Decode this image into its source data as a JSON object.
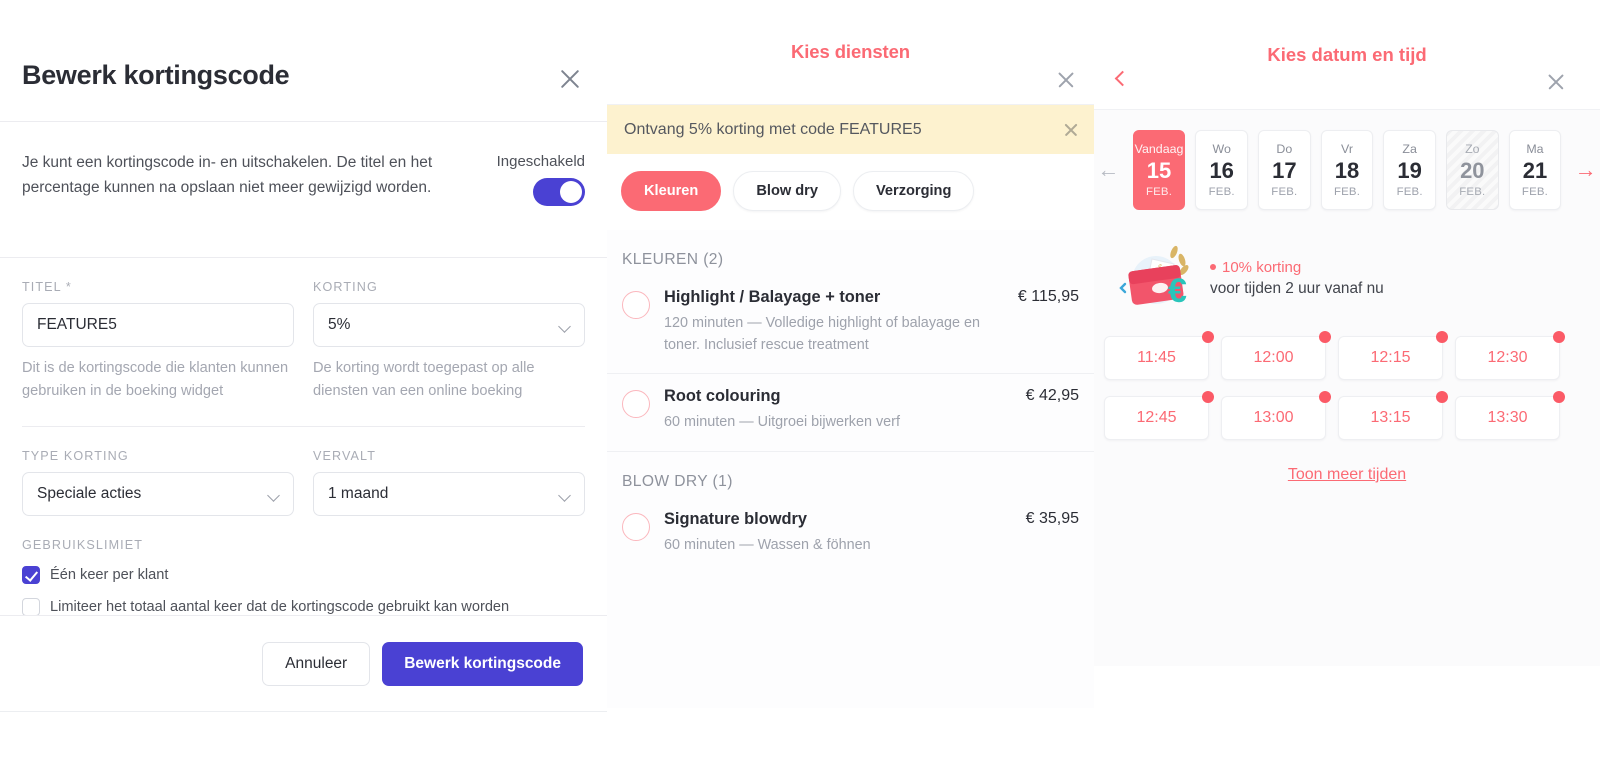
{
  "theme": {
    "accent_red": "#fb6a74",
    "accent_purple": "#4a41d3",
    "promo_yellow": "#fdf2cf"
  },
  "edit_modal": {
    "title": "Bewerk kortingscode",
    "close_icon": "close-icon",
    "intro": "Je kunt een kortingscode in- en uitschakelen. De titel en het percentage kunnen na opslaan niet meer gewijzigd worden.",
    "toggle": {
      "label": "Ingeschakeld",
      "state": "on"
    },
    "fields": {
      "titel": {
        "label": "TITEL *",
        "value": "FEATURE5",
        "placeholder": "FEATURE5",
        "help": "Dit is de kortingscode die klanten kunnen gebruiken in de boeking widget"
      },
      "korting": {
        "label": "KORTING",
        "value": "5%",
        "help": "De korting wordt toegepast op alle diensten van een online boeking"
      },
      "type_korting": {
        "label": "TYPE KORTING",
        "value": "Speciale acties"
      },
      "vervalt": {
        "label": "VERVALT",
        "value": "1 maand"
      }
    },
    "usage_limit": {
      "label": "GEBRUIKSLIMIET",
      "options": [
        {
          "label": "Één keer per klant",
          "checked": true
        },
        {
          "label": "Limiteer het totaal aantal keer dat de kortingscode gebruikt kan worden",
          "checked": false
        }
      ]
    },
    "footer": {
      "cancel": "Annuleer",
      "submit": "Bewerk kortingscode"
    }
  },
  "services_panel": {
    "title": "Kies diensten",
    "close_icon": "close-icon",
    "promo": {
      "text": "Ontvang 5% korting met code FEATURE5",
      "close_icon": "close-icon"
    },
    "chips": [
      {
        "label": "Kleuren",
        "active": true
      },
      {
        "label": "Blow dry",
        "active": false
      },
      {
        "label": "Verzorging",
        "active": false
      }
    ],
    "groups": [
      {
        "title": "KLEUREN (2)",
        "items": [
          {
            "name": "Highlight / Balayage + toner",
            "price": "€ 115,95",
            "desc": "120 minuten — Volledige highlight of balayage en toner. Inclusief rescue treatment"
          },
          {
            "name": "Root colouring",
            "price": "€ 42,95",
            "desc": "60 minuten — Uitgroei bijwerken verf"
          }
        ]
      },
      {
        "title": "BLOW DRY (1)",
        "items": [
          {
            "name": "Signature blowdry",
            "price": "€ 35,95",
            "desc": "60 minuten — Wassen & föhnen"
          }
        ]
      }
    ]
  },
  "datetime_panel": {
    "title": "Kies datum en tijd",
    "back_icon": "chevron-left-icon",
    "close_icon": "close-icon",
    "nav": {
      "prev_icon": "arrow-left-icon",
      "prev_glyph": "←",
      "next_icon": "arrow-right-icon",
      "next_glyph": "→"
    },
    "days": [
      {
        "dow": "Vandaag",
        "day": "15",
        "month": "FEB.",
        "state": "selected"
      },
      {
        "dow": "Wo",
        "day": "16",
        "month": "FEB.",
        "state": "available"
      },
      {
        "dow": "Do",
        "day": "17",
        "month": "FEB.",
        "state": "available"
      },
      {
        "dow": "Vr",
        "day": "18",
        "month": "FEB.",
        "state": "available"
      },
      {
        "dow": "Za",
        "day": "19",
        "month": "FEB.",
        "state": "available"
      },
      {
        "dow": "Zo",
        "day": "20",
        "month": "FEB.",
        "state": "disabled"
      },
      {
        "dow": "Ma",
        "day": "21",
        "month": "FEB.",
        "state": "available"
      }
    ],
    "discount_banner": {
      "illustration": "wallet-euro-illustration",
      "line1": "10% korting",
      "line2": "voor tijden 2 uur vanaf nu"
    },
    "slots": [
      {
        "time": "11:45",
        "badge": true
      },
      {
        "time": "12:00",
        "badge": true
      },
      {
        "time": "12:15",
        "badge": true
      },
      {
        "time": "12:30",
        "badge": true
      },
      {
        "time": "12:45",
        "badge": true
      },
      {
        "time": "13:00",
        "badge": true
      },
      {
        "time": "13:15",
        "badge": true
      },
      {
        "time": "13:30",
        "badge": true
      }
    ],
    "show_more": "Toon meer tijden"
  }
}
